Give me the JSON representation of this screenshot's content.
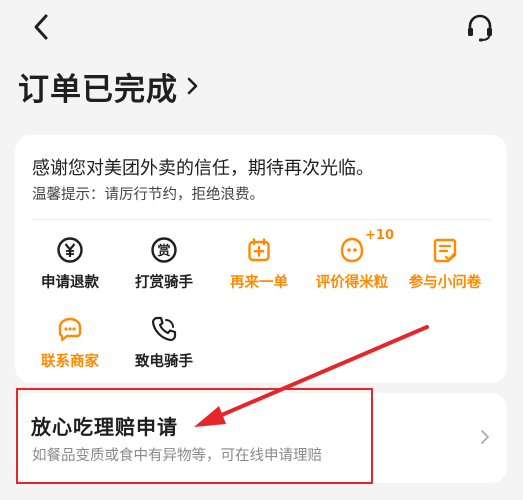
{
  "header": {
    "back_icon": "chevron-left-icon",
    "support_icon": "headset-icon"
  },
  "order": {
    "status_title": "订单已完成",
    "status_chevron_icon": "chevron-right-icon"
  },
  "thanks_card": {
    "thanks_text": "感谢您对美团外卖的信任，期待再次光临。",
    "tip_text": "温馨提示：请厉行节约，拒绝浪费。"
  },
  "actions": [
    {
      "label": "申请退款",
      "icon": "refund-yen-icon",
      "color": "#1f1f1f"
    },
    {
      "label": "打赏骑手",
      "icon": "reward-icon",
      "color": "#1f1f1f"
    },
    {
      "label": "再来一单",
      "icon": "reorder-bag-icon",
      "color": "#ff8a00"
    },
    {
      "label": "评价得米粒",
      "icon": "review-face-icon",
      "color": "#ff8a00",
      "badge": "+10"
    },
    {
      "label": "参与小问卷",
      "icon": "survey-icon",
      "color": "#ff8a00"
    },
    {
      "label": "联系商家",
      "icon": "merchant-chat-icon",
      "color": "#ff8a00"
    },
    {
      "label": "致电骑手",
      "icon": "phone-icon",
      "color": "#1f1f1f"
    }
  ],
  "claim_card": {
    "title": "放心吃理赔申请",
    "description": "如餐品变质或食中有异物等，可在线申请理赔",
    "chevron_icon": "chevron-right-icon"
  },
  "annotation": {
    "box_color": "#e5262b",
    "arrow_color": "#e5262b"
  },
  "colors": {
    "accent": "#ff8a00",
    "background": "#f4f4f4",
    "card": "#ffffff"
  }
}
